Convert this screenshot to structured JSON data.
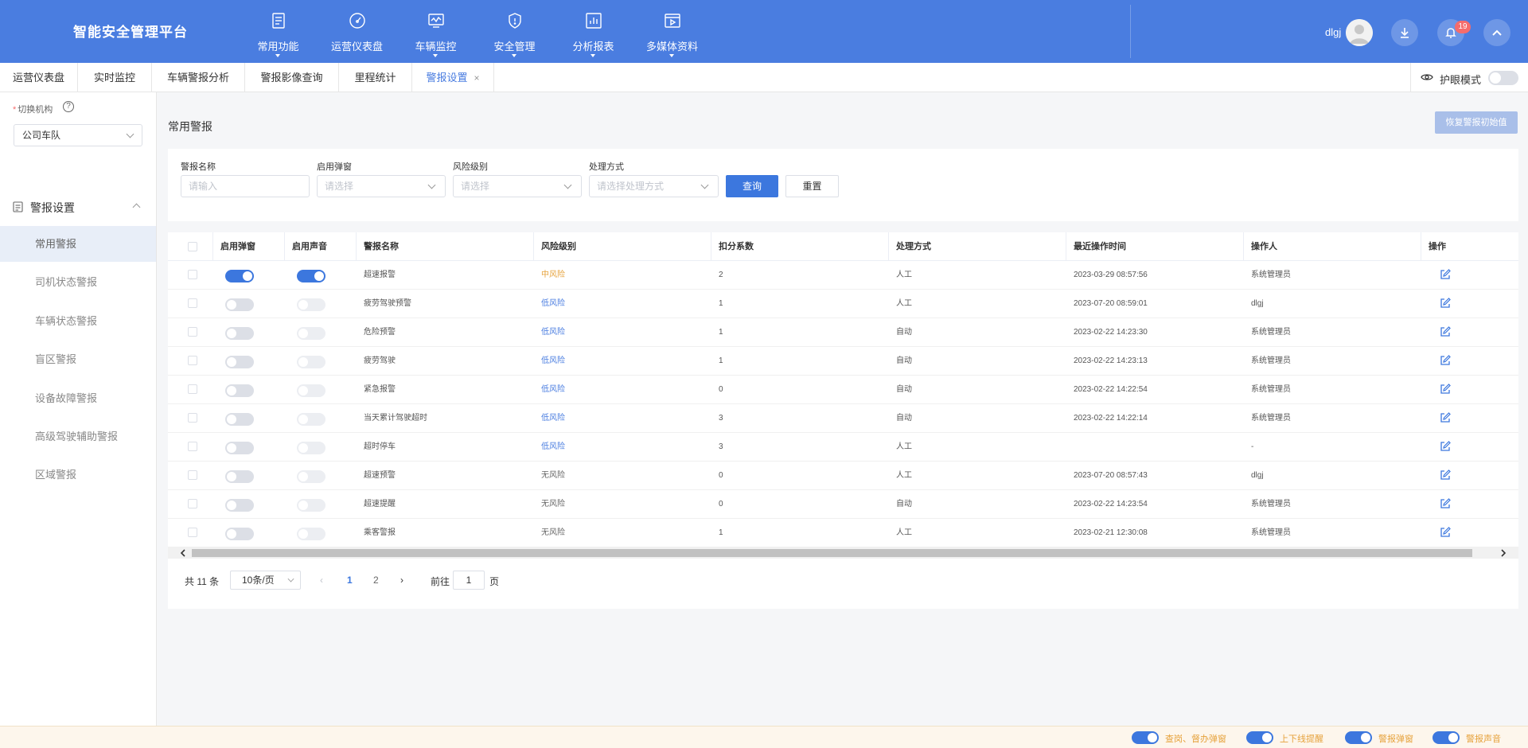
{
  "app": {
    "title": "智能安全管理平台"
  },
  "nav": [
    {
      "label": "常用功能",
      "icon": "clipboard-icon"
    },
    {
      "label": "运营仪表盘",
      "icon": "gauge-icon"
    },
    {
      "label": "车辆监控",
      "icon": "monitor-chart-icon"
    },
    {
      "label": "安全管理",
      "icon": "shield-icon"
    },
    {
      "label": "分析报表",
      "icon": "bar-chart-icon"
    },
    {
      "label": "多媒体资料",
      "icon": "video-icon"
    }
  ],
  "user": {
    "name": "dlgj",
    "notifications": "19"
  },
  "tabs": [
    {
      "label": "运营仪表盘"
    },
    {
      "label": "实时监控"
    },
    {
      "label": "车辆警报分析"
    },
    {
      "label": "警报影像查询"
    },
    {
      "label": "里程统计"
    },
    {
      "label": "警报设置",
      "close": "×"
    }
  ],
  "eye_mode": {
    "label": "护眼模式"
  },
  "sidebar": {
    "org_label": "切换机构",
    "required_mark": "*",
    "help": "?",
    "org_value": "公司车队",
    "section": "警报设置",
    "items": [
      {
        "label": "常用警报"
      },
      {
        "label": "司机状态警报"
      },
      {
        "label": "车辆状态警报"
      },
      {
        "label": "盲区警报"
      },
      {
        "label": "设备故障警报"
      },
      {
        "label": "高级驾驶辅助警报"
      },
      {
        "label": "区域警报"
      }
    ]
  },
  "page": {
    "title": "常用警报",
    "reset_default_label": "恢复警报初始值"
  },
  "filter": {
    "name_label": "警报名称",
    "name_placeholder": "请输入",
    "popup_label": "启用弹窗",
    "popup_placeholder": "请选择",
    "risk_label": "风险级别",
    "risk_placeholder": "请选择",
    "method_label": "处理方式",
    "method_placeholder": "请选择处理方式",
    "query_label": "查询",
    "reset_label": "重置"
  },
  "table": {
    "headers": [
      "启用弹窗",
      "启用声音",
      "警报名称",
      "风险级别",
      "扣分系数",
      "处理方式",
      "最近操作时间",
      "操作人",
      "操作"
    ],
    "rows": [
      {
        "popup": true,
        "sound": true,
        "name": "超速报警",
        "risk": "中风险",
        "coef": "2",
        "method": "人工",
        "time": "2023-03-29 08:57:56",
        "operator": "系统管理员"
      },
      {
        "popup": false,
        "sound": false,
        "name": "疲劳驾驶预警",
        "risk": "低风险",
        "coef": "1",
        "method": "人工",
        "time": "2023-07-20 08:59:01",
        "operator": "dlgj"
      },
      {
        "popup": false,
        "sound": false,
        "name": "危险预警",
        "risk": "低风险",
        "coef": "1",
        "method": "自动",
        "time": "2023-02-22 14:23:30",
        "operator": "系统管理员"
      },
      {
        "popup": false,
        "sound": false,
        "name": "疲劳驾驶",
        "risk": "低风险",
        "coef": "1",
        "method": "自动",
        "time": "2023-02-22 14:23:13",
        "operator": "系统管理员"
      },
      {
        "popup": false,
        "sound": false,
        "name": "紧急报警",
        "risk": "低风险",
        "coef": "0",
        "method": "自动",
        "time": "2023-02-22 14:22:54",
        "operator": "系统管理员"
      },
      {
        "popup": false,
        "sound": false,
        "name": "当天累计驾驶超时",
        "risk": "低风险",
        "coef": "3",
        "method": "自动",
        "time": "2023-02-22 14:22:14",
        "operator": "系统管理员"
      },
      {
        "popup": false,
        "sound": false,
        "name": "超时停车",
        "risk": "低风险",
        "coef": "3",
        "method": "人工",
        "time": "",
        "operator": "-"
      },
      {
        "popup": false,
        "sound": false,
        "name": "超速预警",
        "risk": "无风险",
        "coef": "0",
        "method": "人工",
        "time": "2023-07-20 08:57:43",
        "operator": "dlgj"
      },
      {
        "popup": false,
        "sound": false,
        "name": "超速提醒",
        "risk": "无风险",
        "coef": "0",
        "method": "自动",
        "time": "2023-02-22 14:23:54",
        "operator": "系统管理员"
      },
      {
        "popup": false,
        "sound": false,
        "name": "乘客警报",
        "risk": "无风险",
        "coef": "1",
        "method": "人工",
        "time": "2023-02-21 12:30:08",
        "operator": "系统管理员"
      }
    ]
  },
  "risk_colors": {
    "中风险": "#e6a23c",
    "低风险": "#4a7de0",
    "无风险": "#666666"
  },
  "pager": {
    "total": "共 11 条",
    "page_size": "10条/页",
    "pages": [
      "1",
      "2"
    ],
    "goto_prefix": "前往",
    "goto_value": "1",
    "goto_suffix": "页"
  },
  "footer": [
    {
      "label": "查岗、督办弹窗"
    },
    {
      "label": "上下线提醒"
    },
    {
      "label": "警报弹窗"
    },
    {
      "label": "警报声音"
    }
  ]
}
